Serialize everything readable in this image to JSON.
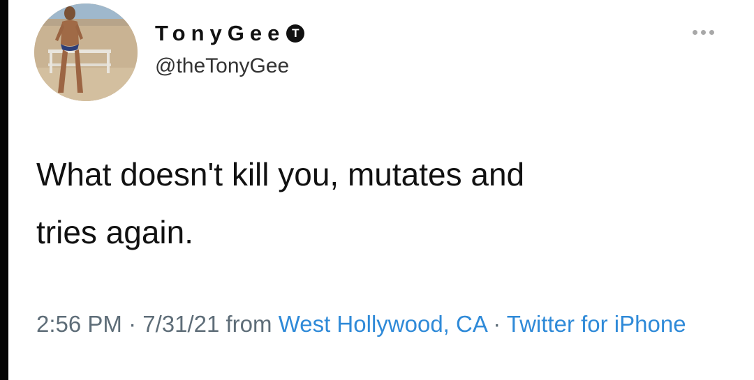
{
  "author": {
    "display_name": "TonyGee",
    "badge_letter": "T",
    "handle": "@theTonyGee",
    "avatar": "profile-photo"
  },
  "more_icon": "more-horizontal-icon",
  "tweet": {
    "line1": "What doesn't kill you, mutates and",
    "line2": "tries again."
  },
  "meta": {
    "time": "2:56 PM",
    "sep1": " · ",
    "date": "7/31/21",
    "from": " from ",
    "location": "West Hollywood, CA",
    "sep2": " · ",
    "source": "Twitter for iPhone"
  },
  "colors": {
    "text": "#111111",
    "secondary": "#5e6d78",
    "link": "#2f8ad8"
  }
}
